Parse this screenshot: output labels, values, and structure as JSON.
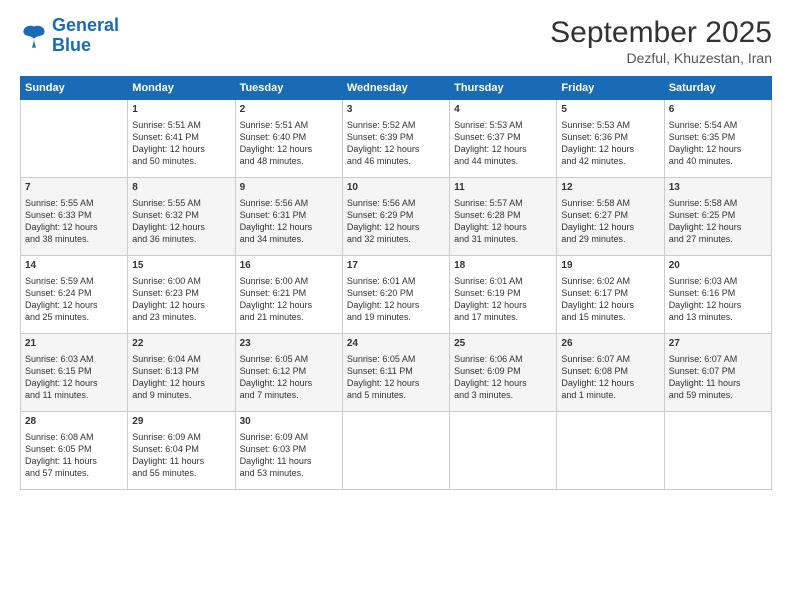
{
  "logo": {
    "line1": "General",
    "line2": "Blue"
  },
  "title": "September 2025",
  "subtitle": "Dezful, Khuzestan, Iran",
  "days_header": [
    "Sunday",
    "Monday",
    "Tuesday",
    "Wednesday",
    "Thursday",
    "Friday",
    "Saturday"
  ],
  "weeks": [
    [
      {
        "day": "",
        "content": ""
      },
      {
        "day": "1",
        "content": "Sunrise: 5:51 AM\nSunset: 6:41 PM\nDaylight: 12 hours\nand 50 minutes."
      },
      {
        "day": "2",
        "content": "Sunrise: 5:51 AM\nSunset: 6:40 PM\nDaylight: 12 hours\nand 48 minutes."
      },
      {
        "day": "3",
        "content": "Sunrise: 5:52 AM\nSunset: 6:39 PM\nDaylight: 12 hours\nand 46 minutes."
      },
      {
        "day": "4",
        "content": "Sunrise: 5:53 AM\nSunset: 6:37 PM\nDaylight: 12 hours\nand 44 minutes."
      },
      {
        "day": "5",
        "content": "Sunrise: 5:53 AM\nSunset: 6:36 PM\nDaylight: 12 hours\nand 42 minutes."
      },
      {
        "day": "6",
        "content": "Sunrise: 5:54 AM\nSunset: 6:35 PM\nDaylight: 12 hours\nand 40 minutes."
      }
    ],
    [
      {
        "day": "7",
        "content": "Sunrise: 5:55 AM\nSunset: 6:33 PM\nDaylight: 12 hours\nand 38 minutes."
      },
      {
        "day": "8",
        "content": "Sunrise: 5:55 AM\nSunset: 6:32 PM\nDaylight: 12 hours\nand 36 minutes."
      },
      {
        "day": "9",
        "content": "Sunrise: 5:56 AM\nSunset: 6:31 PM\nDaylight: 12 hours\nand 34 minutes."
      },
      {
        "day": "10",
        "content": "Sunrise: 5:56 AM\nSunset: 6:29 PM\nDaylight: 12 hours\nand 32 minutes."
      },
      {
        "day": "11",
        "content": "Sunrise: 5:57 AM\nSunset: 6:28 PM\nDaylight: 12 hours\nand 31 minutes."
      },
      {
        "day": "12",
        "content": "Sunrise: 5:58 AM\nSunset: 6:27 PM\nDaylight: 12 hours\nand 29 minutes."
      },
      {
        "day": "13",
        "content": "Sunrise: 5:58 AM\nSunset: 6:25 PM\nDaylight: 12 hours\nand 27 minutes."
      }
    ],
    [
      {
        "day": "14",
        "content": "Sunrise: 5:59 AM\nSunset: 6:24 PM\nDaylight: 12 hours\nand 25 minutes."
      },
      {
        "day": "15",
        "content": "Sunrise: 6:00 AM\nSunset: 6:23 PM\nDaylight: 12 hours\nand 23 minutes."
      },
      {
        "day": "16",
        "content": "Sunrise: 6:00 AM\nSunset: 6:21 PM\nDaylight: 12 hours\nand 21 minutes."
      },
      {
        "day": "17",
        "content": "Sunrise: 6:01 AM\nSunset: 6:20 PM\nDaylight: 12 hours\nand 19 minutes."
      },
      {
        "day": "18",
        "content": "Sunrise: 6:01 AM\nSunset: 6:19 PM\nDaylight: 12 hours\nand 17 minutes."
      },
      {
        "day": "19",
        "content": "Sunrise: 6:02 AM\nSunset: 6:17 PM\nDaylight: 12 hours\nand 15 minutes."
      },
      {
        "day": "20",
        "content": "Sunrise: 6:03 AM\nSunset: 6:16 PM\nDaylight: 12 hours\nand 13 minutes."
      }
    ],
    [
      {
        "day": "21",
        "content": "Sunrise: 6:03 AM\nSunset: 6:15 PM\nDaylight: 12 hours\nand 11 minutes."
      },
      {
        "day": "22",
        "content": "Sunrise: 6:04 AM\nSunset: 6:13 PM\nDaylight: 12 hours\nand 9 minutes."
      },
      {
        "day": "23",
        "content": "Sunrise: 6:05 AM\nSunset: 6:12 PM\nDaylight: 12 hours\nand 7 minutes."
      },
      {
        "day": "24",
        "content": "Sunrise: 6:05 AM\nSunset: 6:11 PM\nDaylight: 12 hours\nand 5 minutes."
      },
      {
        "day": "25",
        "content": "Sunrise: 6:06 AM\nSunset: 6:09 PM\nDaylight: 12 hours\nand 3 minutes."
      },
      {
        "day": "26",
        "content": "Sunrise: 6:07 AM\nSunset: 6:08 PM\nDaylight: 12 hours\nand 1 minute."
      },
      {
        "day": "27",
        "content": "Sunrise: 6:07 AM\nSunset: 6:07 PM\nDaylight: 11 hours\nand 59 minutes."
      }
    ],
    [
      {
        "day": "28",
        "content": "Sunrise: 6:08 AM\nSunset: 6:05 PM\nDaylight: 11 hours\nand 57 minutes."
      },
      {
        "day": "29",
        "content": "Sunrise: 6:09 AM\nSunset: 6:04 PM\nDaylight: 11 hours\nand 55 minutes."
      },
      {
        "day": "30",
        "content": "Sunrise: 6:09 AM\nSunset: 6:03 PM\nDaylight: 11 hours\nand 53 minutes."
      },
      {
        "day": "",
        "content": ""
      },
      {
        "day": "",
        "content": ""
      },
      {
        "day": "",
        "content": ""
      },
      {
        "day": "",
        "content": ""
      }
    ]
  ]
}
